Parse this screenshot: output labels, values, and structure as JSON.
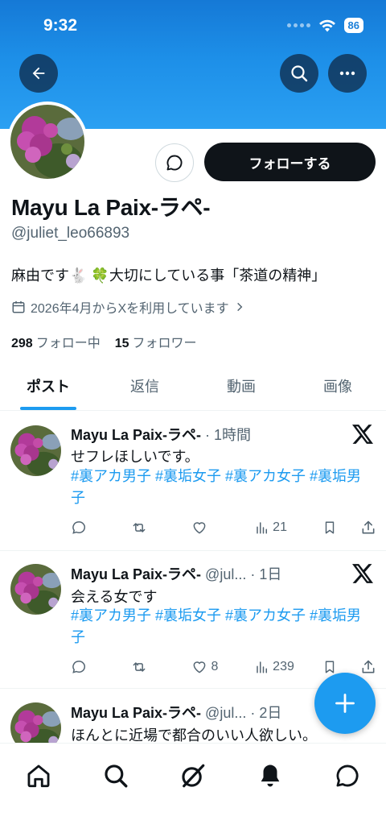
{
  "status_bar": {
    "time": "9:32",
    "battery": "86"
  },
  "profile": {
    "follow_button": "フォローする",
    "display_name": "Mayu La Paix-ラペ-",
    "handle": "@juliet_leo66893",
    "bio": "麻由です🐇 🍀大切にしている事「茶道の精神」",
    "joined": "2026年4月からXを利用しています",
    "following_count": "298",
    "following_label": "フォロー中",
    "followers_count": "15",
    "followers_label": "フォロワー"
  },
  "tabs": [
    {
      "label": "ポスト",
      "active": true
    },
    {
      "label": "返信",
      "active": false
    },
    {
      "label": "動画",
      "active": false
    },
    {
      "label": "画像",
      "active": false
    }
  ],
  "posts": [
    {
      "name": "Mayu La Paix-ラペ-",
      "meta": " · 1時間",
      "text": "せフレほしいです。",
      "tags": "#裏アカ男子 #裏垢女子 #裏アカ女子 #裏垢男子",
      "likes": "",
      "views": "21"
    },
    {
      "name": "Mayu La Paix-ラペ-",
      "meta": " @jul... · 1日",
      "text": "会える女です",
      "tags": "#裏アカ男子 #裏垢女子 #裏アカ女子 #裏垢男子",
      "likes": "8",
      "views": "239"
    },
    {
      "name": "Mayu La Paix-ラペ-",
      "meta": " @jul... · 2日",
      "text": "ほんとに近場で都合のいい人欲しい。",
      "tags": "",
      "likes": "",
      "views": ""
    }
  ],
  "colors": {
    "accent": "#1d9bf0",
    "banner": "#1d8fe8",
    "text": "#0f1419",
    "muted": "#536471"
  },
  "icons": [
    "back-arrow-icon",
    "search-icon",
    "more-icon",
    "message-icon",
    "calendar-icon",
    "chevron-right-icon",
    "x-logo-icon",
    "reply-icon",
    "retweet-icon",
    "like-icon",
    "views-icon",
    "bookmark-icon",
    "share-icon",
    "plus-icon",
    "home-icon",
    "grok-icon",
    "bell-icon",
    "messages-icon"
  ]
}
